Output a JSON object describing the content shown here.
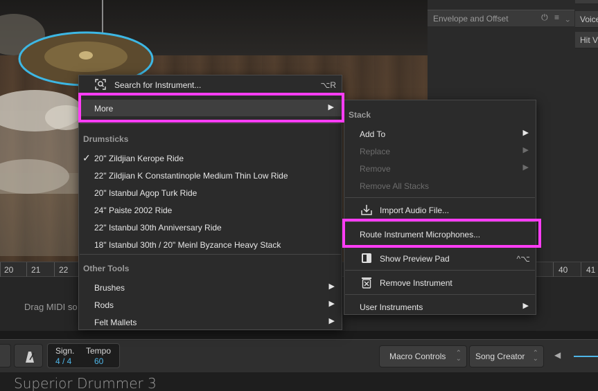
{
  "app": {
    "title": "Superior Drummer 3"
  },
  "right_panel": {
    "envelope_label": "Envelope and Offset",
    "envelope_icons": "⏻ ≡ ⌄",
    "side_buttons": [
      "Voice",
      "Hit V"
    ]
  },
  "timeline": {
    "ticks_left": [
      "20",
      "21",
      "22"
    ],
    "ticks_right": [
      "40",
      "41"
    ]
  },
  "track": {
    "drag_hint": "Drag MIDI so"
  },
  "transport": {
    "sign_label": "Sign.",
    "sign_value": "4 / 4",
    "tempo_label": "Tempo",
    "tempo_value": "60",
    "macro_controls": "Macro Controls",
    "song_creator": "Song Creator"
  },
  "main_menu": {
    "search": {
      "label": "Search for Instrument...",
      "shortcut": "⌥R"
    },
    "more": {
      "label": "More"
    },
    "drumsticks_header": "Drumsticks",
    "drumsticks": [
      {
        "label": "20\" Zildjian Kerope Ride",
        "checked": true
      },
      {
        "label": "22\" Zildjian K Constantinople Medium Thin Low Ride",
        "checked": false
      },
      {
        "label": "20\" Istanbul Agop Turk Ride",
        "checked": false
      },
      {
        "label": "24\" Paiste 2002 Ride",
        "checked": false
      },
      {
        "label": "22\" Istanbul 30th Anniversary Ride",
        "checked": false
      },
      {
        "label": "18\" Istanbul 30th / 20\" Meinl Byzance Heavy Stack",
        "checked": false
      }
    ],
    "other_tools_header": "Other Tools",
    "other_tools": [
      "Brushes",
      "Rods",
      "Felt Mallets"
    ]
  },
  "sub_menu": {
    "stack_header": "Stack",
    "add_to": "Add To",
    "replace": "Replace",
    "remove": "Remove",
    "remove_all_stacks": "Remove All Stacks",
    "import_audio": "Import Audio File...",
    "route_mics": "Route Instrument Microphones...",
    "show_preview_pad": "Show Preview Pad",
    "show_preview_shortcut": "^⌥",
    "remove_instrument": "Remove Instrument",
    "user_instruments": "User Instruments"
  },
  "colors": {
    "highlight": "#ff3df5",
    "accent": "#4fb6e8",
    "cymbal_ring": "#3db7e4"
  }
}
